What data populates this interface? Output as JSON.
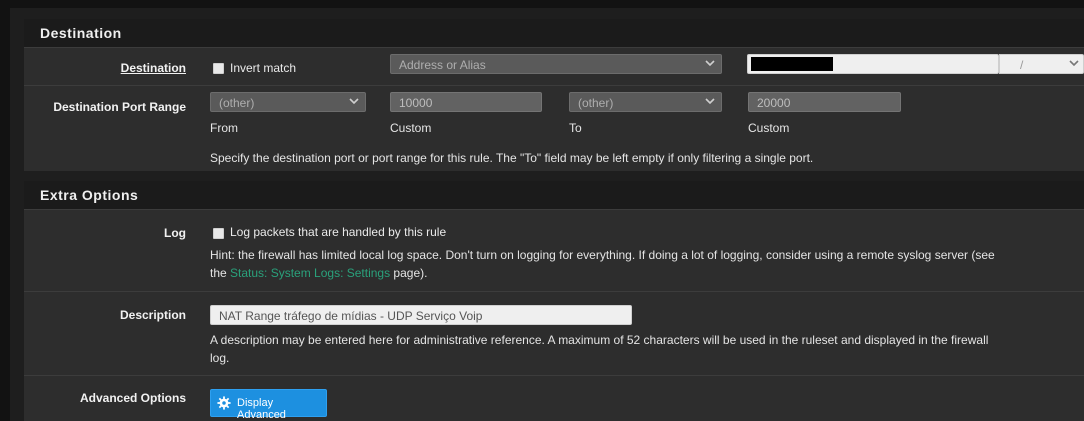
{
  "destination_section": {
    "heading": "Destination",
    "destination": {
      "label": "Destination",
      "invert_label": "Invert match",
      "type_select": "Address or Alias",
      "mask_separator": "/"
    },
    "port_range": {
      "label": "Destination Port Range",
      "from_select": "(other)",
      "from_custom": "10000",
      "to_select": "(other)",
      "to_custom": "20000",
      "from_caption": "From",
      "custom_caption_1": "Custom",
      "to_caption": "To",
      "custom_caption_2": "Custom",
      "help": "Specify the destination port or port range for this rule. The \"To\" field may be left empty if only filtering a single port."
    }
  },
  "extra_section": {
    "heading": "Extra Options",
    "log": {
      "label": "Log",
      "checkbox_label": "Log packets that are handled by this rule",
      "hint_1": "Hint: the firewall has limited local log space. Don't turn on logging for everything. If doing a lot of logging, consider using a remote syslog server (see",
      "hint_2_prefix": "the ",
      "hint_link": "Status: System Logs: Settings",
      "hint_2_suffix": " page)."
    },
    "description": {
      "label": "Description",
      "value": "NAT Range tráfego de mídias - UDP Serviço Voip",
      "help_1": "A description may be entered here for administrative reference. A maximum of 52 characters will be used in the ruleset and displayed in the firewall",
      "help_2": "log."
    },
    "advanced": {
      "label": "Advanced Options",
      "button": "Display Advanced"
    }
  },
  "colors": {
    "heading_bg": "#1b1b1b",
    "row_bg": "#2d2d2d",
    "link": "#2aa17b",
    "button_blue": "#1d90e0"
  }
}
